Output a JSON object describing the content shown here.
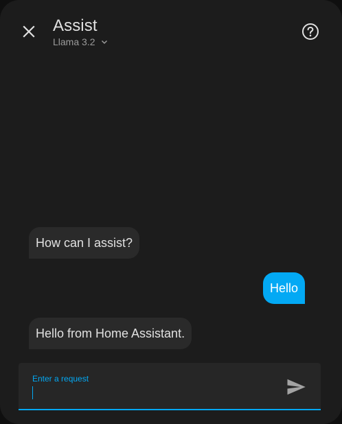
{
  "dialog": {
    "title": "Assist",
    "pipeline": "Llama 3.2",
    "icons": {
      "close": "close-icon",
      "help": "help-circle-icon",
      "chevron": "chevron-down-icon",
      "send": "send-icon"
    }
  },
  "conversation": [
    {
      "who": "agent",
      "text": "How can I assist?"
    },
    {
      "who": "user",
      "text": "Hello"
    },
    {
      "who": "agent",
      "text": "Hello from Home Assistant."
    }
  ],
  "input": {
    "label": "Enter a request",
    "value": ""
  },
  "colors": {
    "accent": "#03a9f4",
    "background": "#1c1c1c",
    "agent_bubble": "#2a2a2a",
    "text": "#e1e1e1"
  }
}
